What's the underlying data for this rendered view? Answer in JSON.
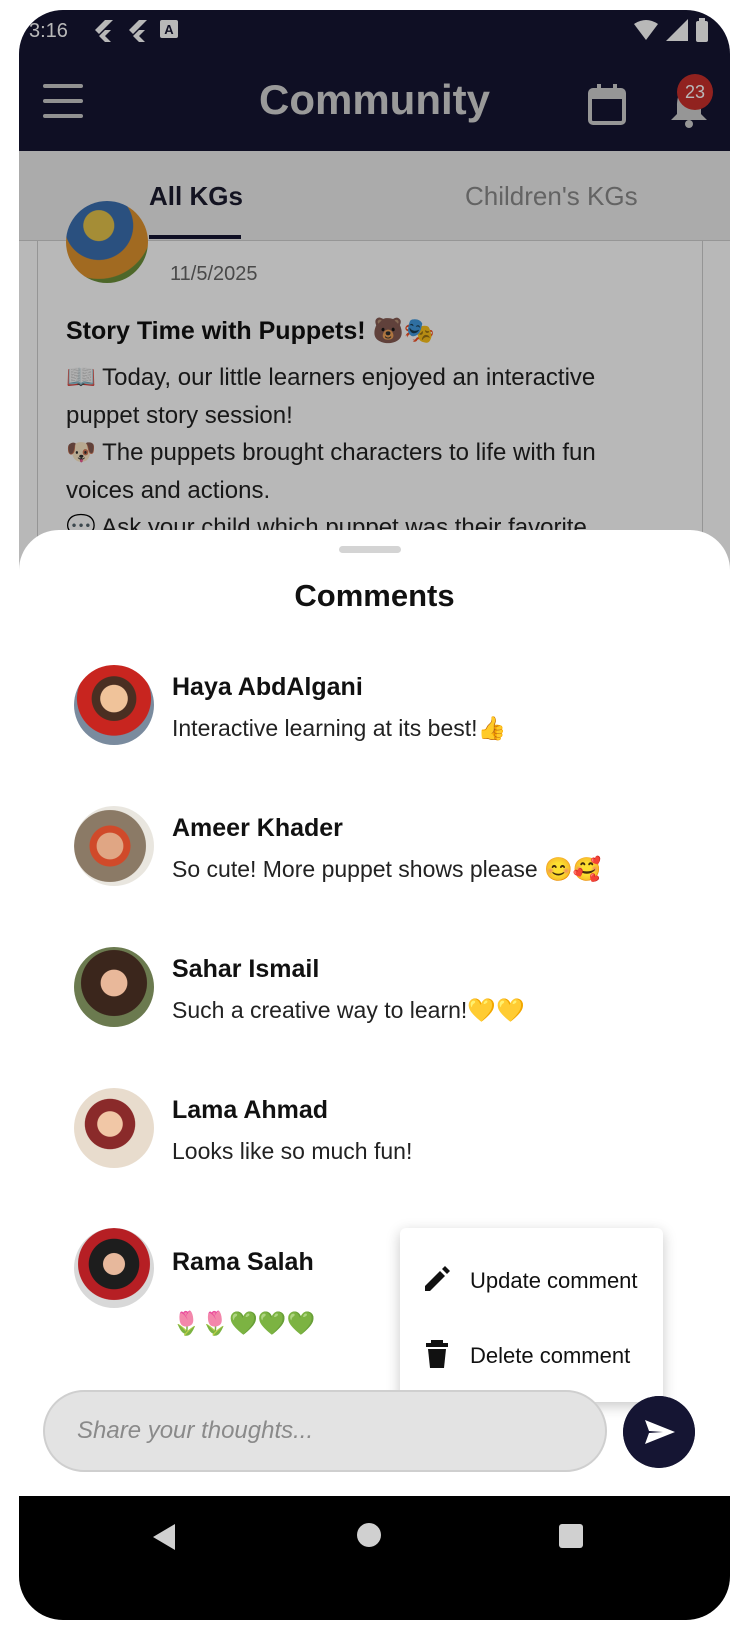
{
  "status_bar": {
    "time": "3:16"
  },
  "app_bar": {
    "title": "Community",
    "notification_count": "23"
  },
  "tabs": [
    {
      "label": "All KGs",
      "active": true
    },
    {
      "label": "Children's KGs",
      "active": false
    }
  ],
  "post": {
    "date": "11/5/2025",
    "title": "Story Time with Puppets! 🐻🎭",
    "body_lines": [
      "📖 Today, our little learners enjoyed an interactive puppet story session!",
      "🐶 The puppets brought characters to life with fun voices and actions.",
      "💬 Ask your child which puppet was their favorite"
    ]
  },
  "comments_sheet": {
    "title": "Comments",
    "comments": [
      {
        "name": "Haya AbdAlgani",
        "text": "Interactive learning at its best!👍"
      },
      {
        "name": "Ameer Khader",
        "text": "So cute! More puppet shows please 😊🥰"
      },
      {
        "name": "Sahar Ismail",
        "text": "Such a creative way to learn!💛💛"
      },
      {
        "name": "Lama Ahmad",
        "text": "Looks like so much fun!"
      },
      {
        "name": "Rama Salah",
        "text": "🌷🌷💚💚💚"
      }
    ]
  },
  "context_menu": {
    "update_label": "Update comment",
    "delete_label": "Delete comment"
  },
  "input": {
    "placeholder": "Share your thoughts..."
  },
  "colors": {
    "primary": "#151533",
    "badge": "#c9302c"
  }
}
